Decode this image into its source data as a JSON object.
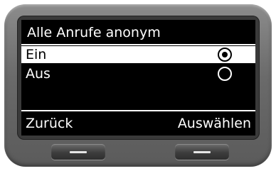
{
  "screen": {
    "title": "Alle Anrufe anonym",
    "options": [
      {
        "label": "Ein",
        "selected": true
      },
      {
        "label": "Aus",
        "selected": false
      }
    ]
  },
  "softkeys": {
    "left_label": "Zurück",
    "right_label": "Auswählen"
  },
  "icons": {
    "radio_selected": "radio-selected-icon",
    "radio_unselected": "radio-unselected-icon",
    "softkey_bar": "minus-bar-icon"
  }
}
